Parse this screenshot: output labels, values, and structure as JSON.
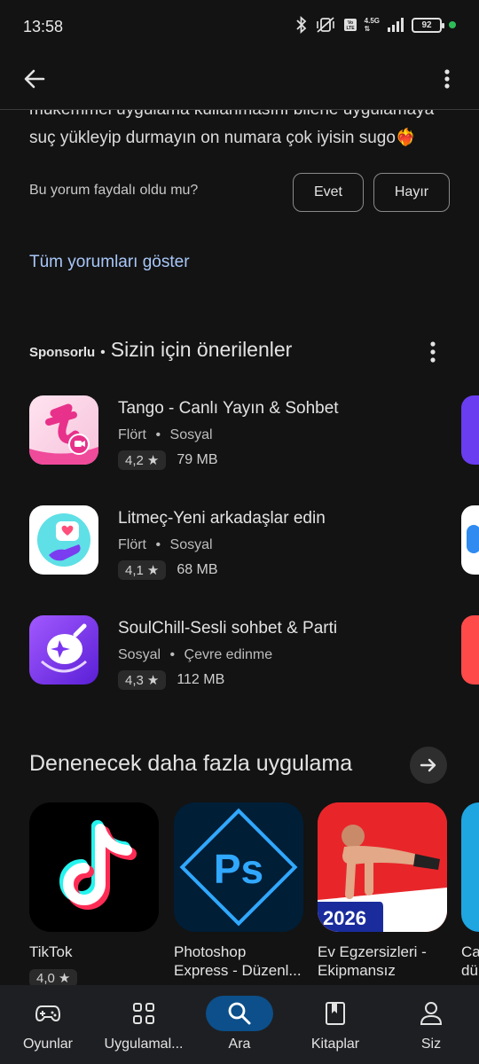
{
  "status": {
    "time": "13:58",
    "network": "4.5G",
    "battery": "92"
  },
  "header": {
    "back_icon": "arrow-left-icon",
    "more_icon": "more-vert-icon"
  },
  "review": {
    "text_line1": "mükemmel uygulama kullanmasını bilene uygulamaya",
    "text_line2": "suç yükleyip durmayın on numara çok iyisin sugo❤️‍🔥",
    "helpful_question": "Bu yorum faydalı oldu mu?",
    "yes_label": "Evet",
    "no_label": "Hayır"
  },
  "all_reviews_label": "Tüm yorumları göster",
  "recommended": {
    "sponsored_label": "Sponsorlu",
    "separator": "•",
    "title": "Sizin için önerilenler",
    "apps": [
      {
        "name": "Tango - Canlı Yayın & Sohbet",
        "cat1": "Flört",
        "cat2": "Sosyal",
        "rating": "4,2",
        "size": "79 MB",
        "icon": "tango-icon"
      },
      {
        "name": "Litmeç-Yeni arkadaşlar edin",
        "cat1": "Flört",
        "cat2": "Sosyal",
        "rating": "4,1",
        "size": "68 MB",
        "icon": "litmec-icon"
      },
      {
        "name": "SoulChill-Sesli sohbet & Parti",
        "cat1": "Sosyal",
        "cat2": "Çevre edinme",
        "rating": "4,3",
        "size": "112 MB",
        "icon": "soulchill-icon"
      }
    ]
  },
  "more_apps": {
    "title": "Denenecek daha fazla uygulama",
    "items": [
      {
        "name": "TikTok",
        "rating": "4,0",
        "icon": "tiktok-icon"
      },
      {
        "name_line1": "Photoshop",
        "name_line2": "Express - Düzenl...",
        "icon": "photoshop-express-icon"
      },
      {
        "name_line1": "Ev Egzersizleri -",
        "name_line2": "Ekipmansız",
        "badge": "2026",
        "icon": "home-workout-icon"
      },
      {
        "name_line1": "Ca",
        "name_line2": "dü"
      }
    ]
  },
  "nav": [
    {
      "label": "Oyunlar",
      "icon": "gamepad-icon",
      "active": false
    },
    {
      "label": "Uygulamal...",
      "icon": "apps-grid-icon",
      "active": false
    },
    {
      "label": "Ara",
      "icon": "search-icon",
      "active": true
    },
    {
      "label": "Kitaplar",
      "icon": "bookmark-book-icon",
      "active": false
    },
    {
      "label": "Siz",
      "icon": "person-icon",
      "active": false
    }
  ],
  "colors": {
    "accent_link": "#a8c7fa",
    "active_nav_bg": "#0c4f8a",
    "background": "#131313"
  }
}
